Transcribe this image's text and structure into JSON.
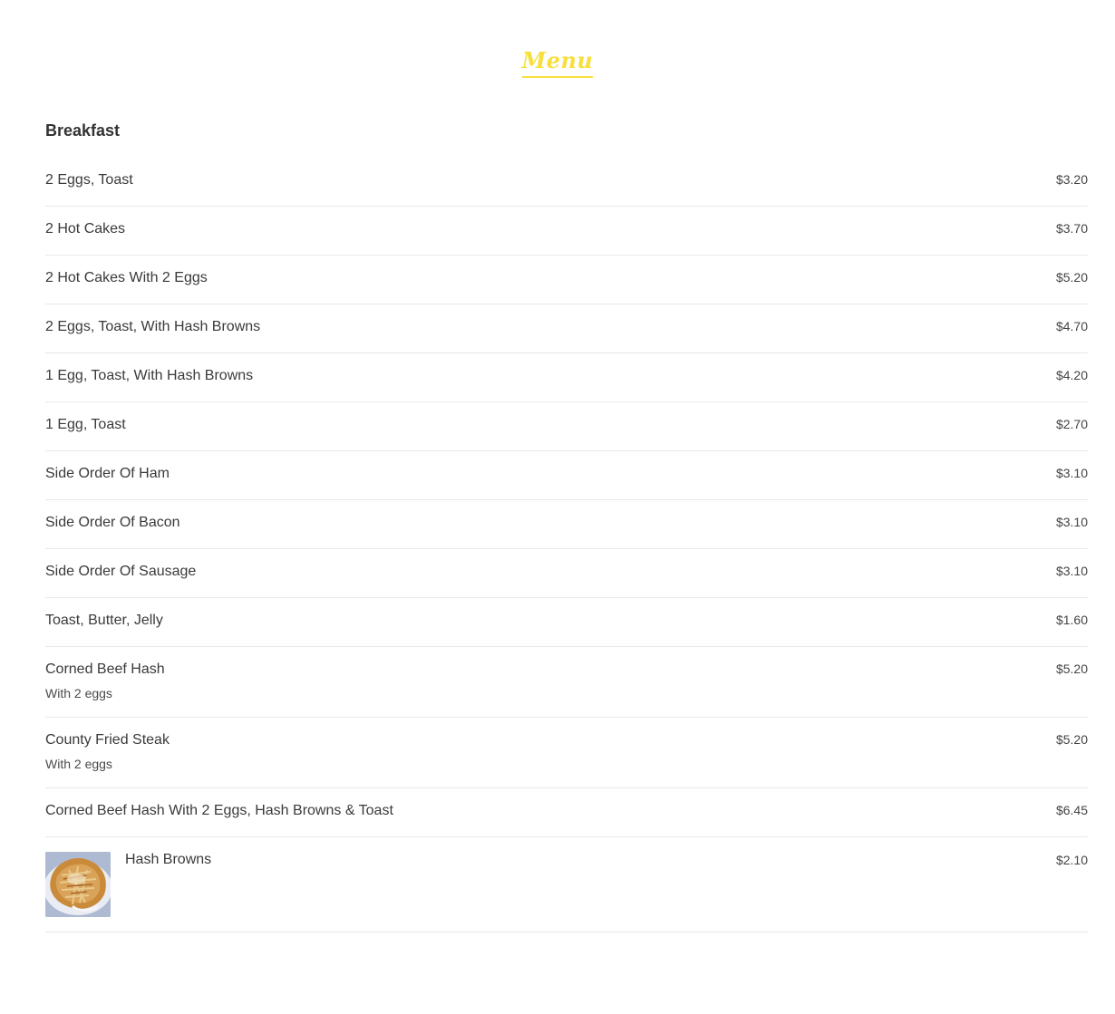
{
  "menu_heading": "Menu",
  "section": {
    "title": "Breakfast",
    "items": [
      {
        "name": "2 Eggs, Toast",
        "price": "$3.20"
      },
      {
        "name": "2 Hot Cakes",
        "price": "$3.70"
      },
      {
        "name": "2 Hot Cakes With 2 Eggs",
        "price": "$5.20"
      },
      {
        "name": "2 Eggs, Toast, With Hash Browns",
        "price": "$4.70"
      },
      {
        "name": "1 Egg, Toast, With Hash Browns",
        "price": "$4.20"
      },
      {
        "name": "1 Egg, Toast",
        "price": "$2.70"
      },
      {
        "name": "Side Order Of Ham",
        "price": "$3.10"
      },
      {
        "name": "Side Order Of Bacon",
        "price": "$3.10"
      },
      {
        "name": "Side Order Of Sausage",
        "price": "$3.10"
      },
      {
        "name": "Toast, Butter, Jelly",
        "price": "$1.60"
      },
      {
        "name": "Corned Beef Hash",
        "description": "With 2 eggs",
        "price": "$5.20"
      },
      {
        "name": "County Fried Steak",
        "description": "With 2 eggs",
        "price": "$5.20"
      },
      {
        "name": "Corned Beef Hash With 2 Eggs, Hash Browns & Toast",
        "price": "$6.45"
      },
      {
        "name": "Hash Browns",
        "price": "$2.10",
        "image": "hash-browns-photo"
      }
    ]
  },
  "colors": {
    "accent": "#f7df3e",
    "text": "#333333",
    "divider": "#e8e8e8"
  }
}
